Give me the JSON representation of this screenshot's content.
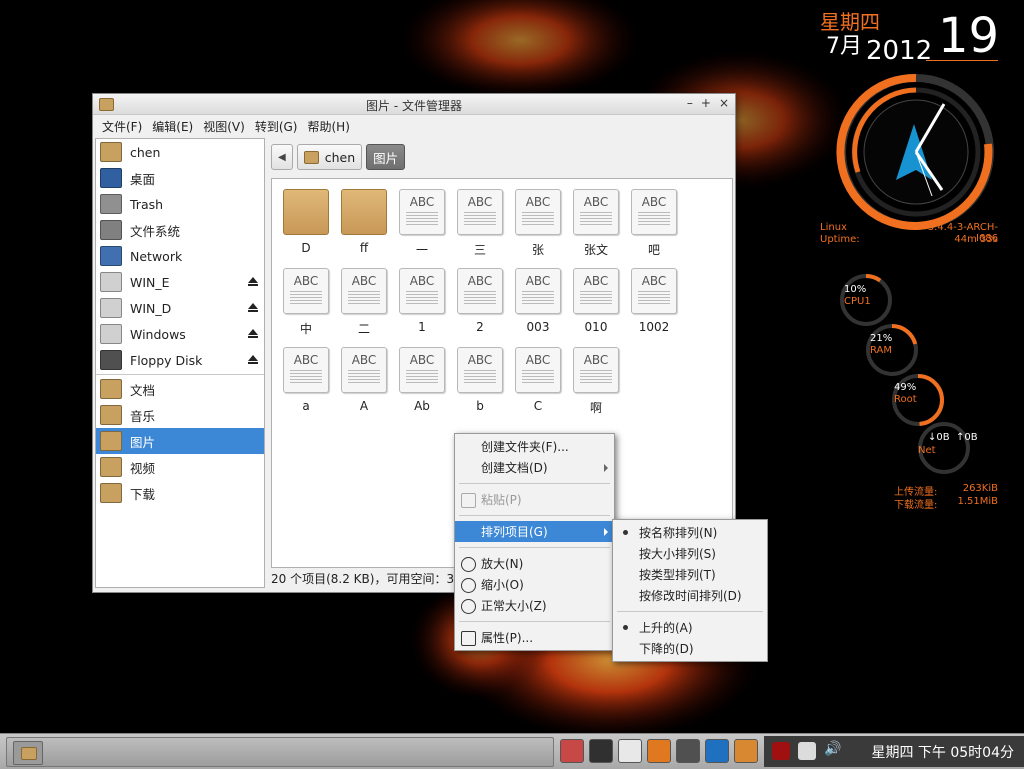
{
  "conky": {
    "weekday": "星期四",
    "month": "7月",
    "year": "2012",
    "day": "19",
    "os_label": "Linux",
    "kernel": "3.4.4-3-ARCH-I686",
    "uptime_label": "Uptime:",
    "uptime": "44m 33s",
    "cpu_pct": "10%",
    "cpu_label": "CPU1",
    "cpu_level": 0.1,
    "ram_pct": "21%",
    "ram_label": "RAM",
    "ram_level": 0.21,
    "root_pct": "49%",
    "root_label": "Root",
    "root_level": 0.49,
    "net_down": "↓0B",
    "net_up": "↑0B",
    "net_label": "Net",
    "upload_label": "上传流量:",
    "upload_value": "263KiB",
    "download_label": "下载流量:",
    "download_value": "1.51MiB"
  },
  "window": {
    "title": "图片 - 文件管理器",
    "menus": [
      "文件(F)",
      "编辑(E)",
      "视图(V)",
      "转到(G)",
      "帮助(H)"
    ],
    "sidebar": [
      {
        "label": "chen",
        "icon": "home-folder-icon",
        "color": "#c8a060"
      },
      {
        "label": "桌面",
        "icon": "desktop-icon",
        "color": "#3060a0"
      },
      {
        "label": "Trash",
        "icon": "trash-icon",
        "color": "#909090"
      },
      {
        "label": "文件系统",
        "icon": "filesystem-icon",
        "color": "#808080"
      },
      {
        "label": "Network",
        "icon": "network-icon",
        "color": "#4070b0"
      },
      {
        "label": "WIN_E",
        "icon": "drive-icon",
        "color": "#d0d0d0",
        "eject": true
      },
      {
        "label": "WIN_D",
        "icon": "drive-icon",
        "color": "#d0d0d0",
        "eject": true
      },
      {
        "label": "Windows",
        "icon": "drive-icon",
        "color": "#d0d0d0",
        "eject": true
      },
      {
        "label": "Floppy Disk",
        "icon": "floppy-icon",
        "color": "#505050",
        "eject": true
      },
      {
        "label": "文档",
        "icon": "documents-folder-icon",
        "color": "#c8a060",
        "sep_before": true
      },
      {
        "label": "音乐",
        "icon": "music-folder-icon",
        "color": "#c8a060"
      },
      {
        "label": "图片",
        "icon": "pictures-folder-icon",
        "color": "#c8a060",
        "selected": true
      },
      {
        "label": "视频",
        "icon": "videos-folder-icon",
        "color": "#c8a060"
      },
      {
        "label": "下载",
        "icon": "downloads-folder-icon",
        "color": "#c8a060"
      }
    ],
    "path": {
      "back": "◀",
      "home": "chen",
      "current": "图片"
    },
    "files": [
      {
        "name": "D",
        "type": "folder"
      },
      {
        "name": "ff",
        "type": "folder"
      },
      {
        "name": "一",
        "type": "doc"
      },
      {
        "name": "三",
        "type": "doc"
      },
      {
        "name": "张",
        "type": "doc"
      },
      {
        "name": "张文",
        "type": "doc"
      },
      {
        "name": "吧",
        "type": "doc"
      },
      {
        "name": "中",
        "type": "doc"
      },
      {
        "name": "二",
        "type": "doc"
      },
      {
        "name": "1",
        "type": "doc"
      },
      {
        "name": "2",
        "type": "doc"
      },
      {
        "name": "003",
        "type": "doc"
      },
      {
        "name": "010",
        "type": "doc"
      },
      {
        "name": "1002",
        "type": "doc"
      },
      {
        "name": "a",
        "type": "doc"
      },
      {
        "name": "A",
        "type": "doc"
      },
      {
        "name": "Ab",
        "type": "doc"
      },
      {
        "name": "b",
        "type": "doc"
      },
      {
        "name": "C",
        "type": "doc"
      },
      {
        "name": "啊",
        "type": "doc"
      }
    ],
    "doc_label": "ABC",
    "status": "20 个项目(8.2 KB)，可用空间：3"
  },
  "context_menu": {
    "items": [
      {
        "label": "创建文件夹(F)..."
      },
      {
        "label": "创建文档(D)",
        "submenu": true
      },
      {
        "sep": true
      },
      {
        "label": "粘贴(P)",
        "disabled": true,
        "icon": "paste-icon"
      },
      {
        "sep": true
      },
      {
        "label": "排列项目(G)",
        "submenu": true,
        "highlight": true
      },
      {
        "sep": true
      },
      {
        "label": "放大(N)",
        "icon": "zoom-in-icon"
      },
      {
        "label": "缩小(O)",
        "icon": "zoom-out-icon"
      },
      {
        "label": "正常大小(Z)",
        "icon": "zoom-normal-icon"
      },
      {
        "sep": true
      },
      {
        "label": "属性(P)...",
        "icon": "properties-icon"
      }
    ]
  },
  "sort_menu": {
    "items": [
      {
        "label": "按名称排列(N)",
        "dot": true
      },
      {
        "label": "按大小排列(S)"
      },
      {
        "label": "按类型排列(T)"
      },
      {
        "label": "按修改时间排列(D)"
      },
      {
        "sep": true
      },
      {
        "label": "上升的(A)",
        "dot": true
      },
      {
        "label": "下降的(D)"
      }
    ]
  },
  "taskbar": {
    "clock": "星期四 下午 05时04分",
    "launchers": [
      "screenshot-icon",
      "terminal-icon",
      "text-editor-icon",
      "firefox-icon",
      "app-a-icon",
      "media-player-icon",
      "paint-icon"
    ],
    "tray": [
      "flame-app-icon",
      "pen-icon",
      "volume-icon"
    ]
  }
}
